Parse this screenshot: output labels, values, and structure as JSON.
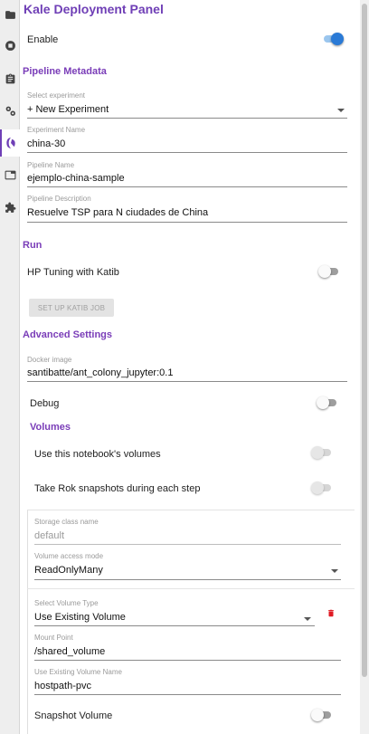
{
  "title": "Kale Deployment Panel",
  "enable": {
    "label": "Enable",
    "on": true
  },
  "pipeline_metadata": {
    "heading": "Pipeline Metadata",
    "experiment": {
      "label": "Select experiment",
      "value": "+ New Experiment"
    },
    "experiment_name": {
      "label": "Experiment Name",
      "value": "china-30"
    },
    "pipeline_name": {
      "label": "Pipeline Name",
      "value": "ejemplo-china-sample"
    },
    "pipeline_description": {
      "label": "Pipeline Description",
      "value": "Resuelve TSP para N ciudades de China"
    }
  },
  "run": {
    "heading": "Run",
    "hp_tuning": {
      "label": "HP Tuning with Katib",
      "on": false
    },
    "katib_button": "SET UP KATIB JOB"
  },
  "advanced": {
    "heading": "Advanced Settings",
    "docker_image": {
      "label": "Docker image",
      "value": "santibatte/ant_colony_jupyter:0.1"
    },
    "debug": {
      "label": "Debug",
      "on": false
    }
  },
  "volumes": {
    "heading": "Volumes",
    "notebook_volumes": {
      "label": "Use this notebook's volumes",
      "on": false
    },
    "rok_snapshots": {
      "label": "Take Rok snapshots during each step",
      "on": false
    },
    "storage_class": {
      "label": "Storage class name",
      "value": "default"
    },
    "access_mode": {
      "label": "Volume access mode",
      "value": "ReadOnlyMany"
    },
    "volume_type": {
      "label": "Select Volume Type",
      "value": "Use Existing Volume"
    },
    "mount_point": {
      "label": "Mount Point",
      "value": "/shared_volume"
    },
    "existing_volume_name": {
      "label": "Use Existing Volume Name",
      "value": "hostpath-pvc"
    },
    "snapshot_volume": {
      "label": "Snapshot Volume",
      "on": false
    }
  },
  "sidebar_icons": [
    "folder-icon",
    "running-icon",
    "commands-icon",
    "settings-icon",
    "kale-icon",
    "tabs-icon",
    "extension-icon"
  ],
  "colors": {
    "accent": "#6f3fb6",
    "toggle_on": "#2a7ad6",
    "delete": "#e01b24"
  }
}
